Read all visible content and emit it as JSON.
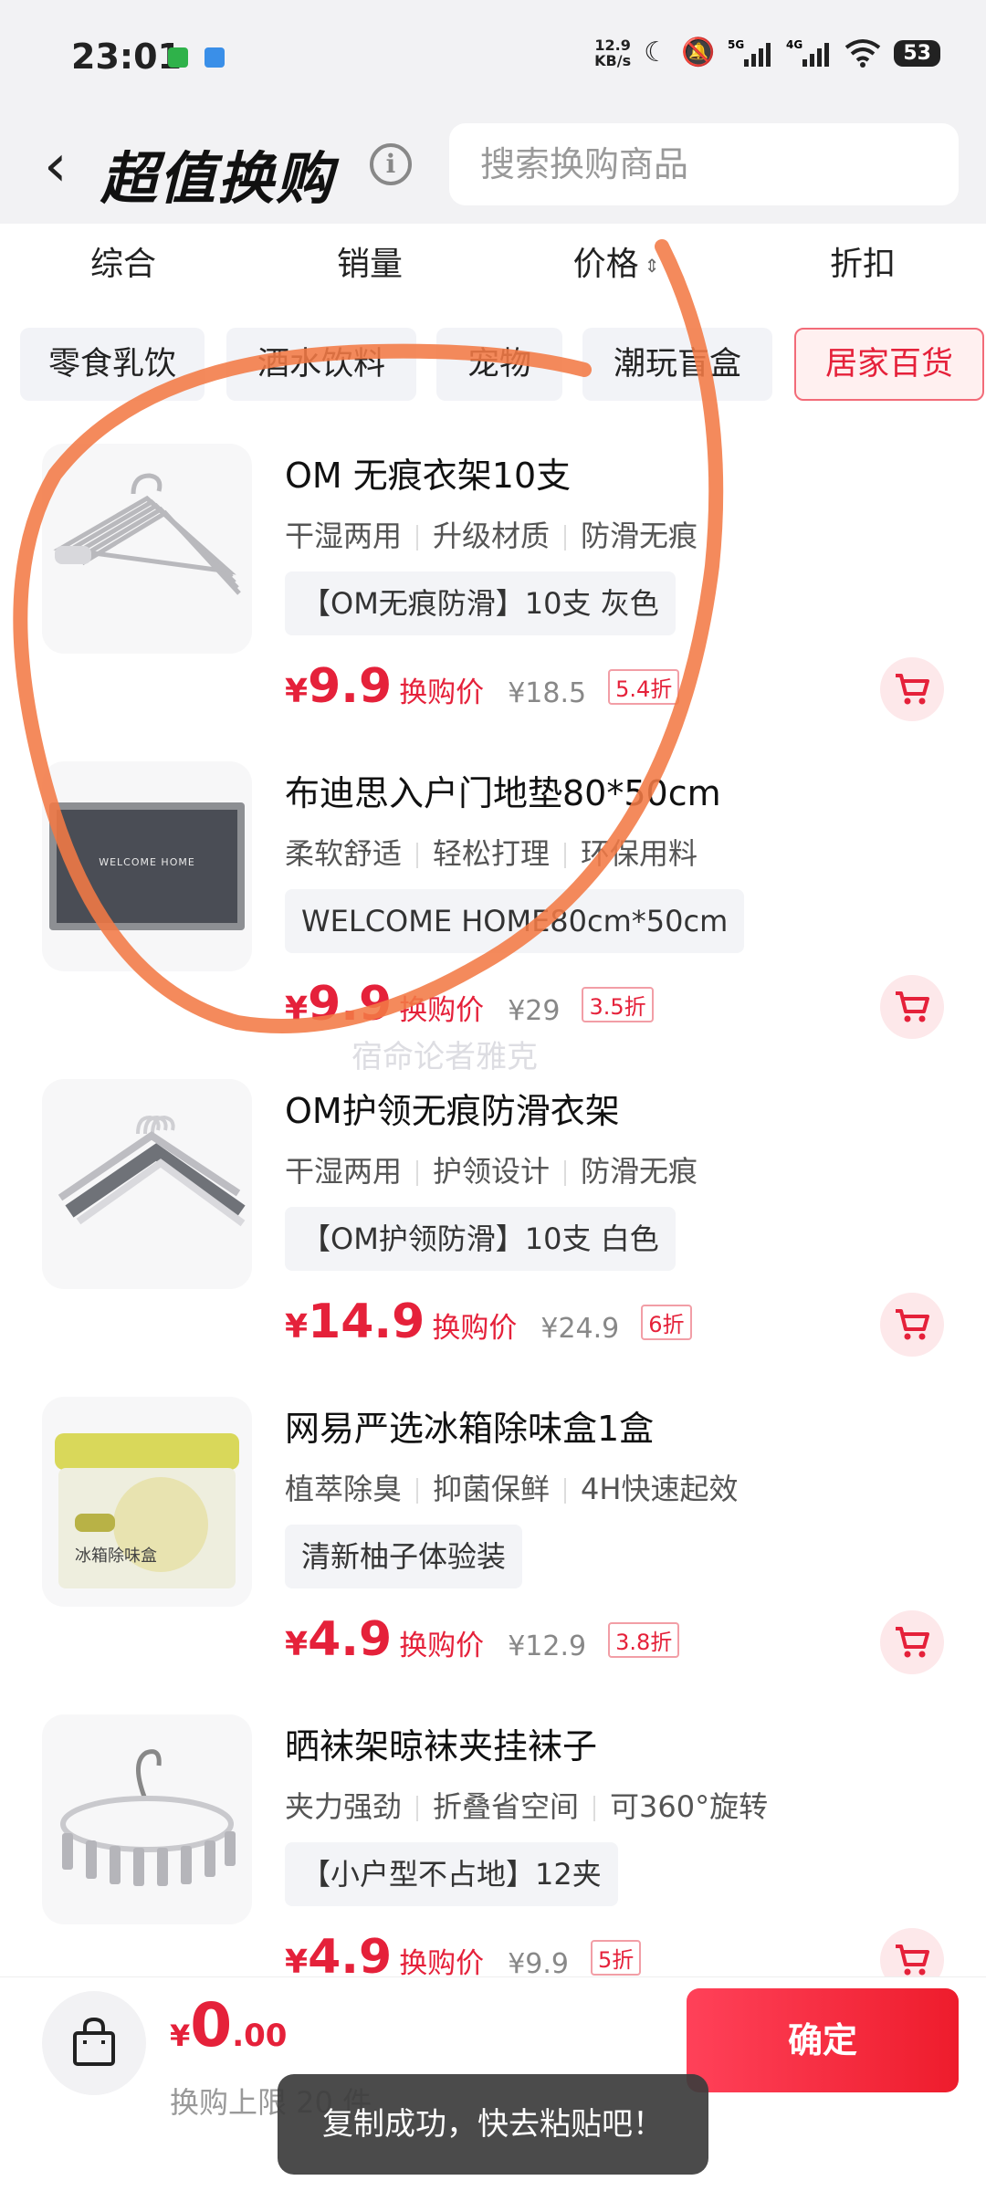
{
  "status_bar": {
    "time": "23:01",
    "net_speed_value": "12.9",
    "net_speed_unit": "KB/s",
    "battery": "53",
    "icons": [
      "moon-icon",
      "mute-icon",
      "signal-5g-icon",
      "signal-4g-icon",
      "wifi-icon",
      "battery-icon"
    ],
    "app_icon_colors": [
      "#2fb24a",
      "#3a8fe8"
    ]
  },
  "header": {
    "back_glyph": "‹",
    "title": "超值换购",
    "info_glyph": "i",
    "search_placeholder": "搜索换购商品"
  },
  "sort_tabs": [
    {
      "label": "综合"
    },
    {
      "label": "销量"
    },
    {
      "label": "价格"
    },
    {
      "label": "折扣"
    }
  ],
  "categories": [
    {
      "label": "零食乳饮",
      "active": false
    },
    {
      "label": "酒水饮料",
      "active": false
    },
    {
      "label": "宠物",
      "active": false
    },
    {
      "label": "潮玩盲盒",
      "active": false
    },
    {
      "label": "居家百货",
      "active": true
    }
  ],
  "products": [
    {
      "name": "OM 无痕衣架10支",
      "tags": [
        "干湿两用",
        "升级材质",
        "防滑无痕"
      ],
      "spec": "【OM无痕防滑】10支 灰色",
      "currency": "¥",
      "price": "9.9",
      "price_label": "换购价",
      "original_price": "¥18.5",
      "discount": "5.4折",
      "image_icon": "hanger-icon"
    },
    {
      "name": "布迪思入户门地垫80*50cm",
      "tags": [
        "柔软舒适",
        "轻松打理",
        "环保用料"
      ],
      "spec": "WELCOME HOME80cm*50cm",
      "mat_text": "WELCOME HOME",
      "currency": "¥",
      "price": "9.9",
      "price_label": "换购价",
      "original_price": "¥29",
      "discount": "3.5折",
      "image_icon": "doormat-icon"
    },
    {
      "name": "OM护领无痕防滑衣架",
      "tags": [
        "干湿两用",
        "护领设计",
        "防滑无痕"
      ],
      "spec": "【OM护领防滑】10支 白色",
      "currency": "¥",
      "price": "14.9",
      "price_label": "换购价",
      "original_price": "¥24.9",
      "discount": "6折",
      "image_icon": "hanger-icon"
    },
    {
      "name": "网易严选冰箱除味盒1盒",
      "tags": [
        "植萃除臭",
        "抑菌保鲜",
        "4H快速起效"
      ],
      "spec": "清新柚子体验装",
      "box_label": "冰箱除味盒",
      "currency": "¥",
      "price": "4.9",
      "price_label": "换购价",
      "original_price": "¥12.9",
      "discount": "3.8折",
      "image_icon": "deodorizer-box-icon"
    },
    {
      "name": "晒袜架晾袜夹挂袜子",
      "tags": [
        "夹力强劲",
        "折叠省空间",
        "可360°旋转"
      ],
      "spec": "【小户型不占地】12夹",
      "currency": "¥",
      "price": "4.9",
      "price_label": "换购价",
      "original_price": "¥9.9",
      "discount": "5折",
      "image_icon": "sock-clip-rack-icon"
    }
  ],
  "watermark": "宿命论者雅克",
  "bottom": {
    "currency": "¥",
    "total_int": "0",
    "total_dec": ".00",
    "limit": "换购上限 20 件",
    "confirm_label": "确定"
  },
  "toast": "复制成功，快去粘贴吧！",
  "colors": {
    "accent_red": "#e5213a",
    "annotation_orange": "#f37a45",
    "page_bg": "#f2f2f4"
  }
}
